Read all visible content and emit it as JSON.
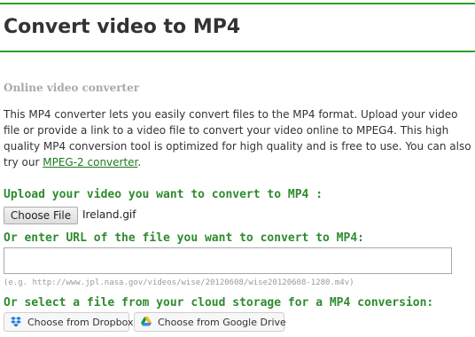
{
  "page": {
    "title": "Convert video to MP4",
    "subtitle": "Online video converter",
    "description_text": "This MP4 converter lets you easily convert files to the MP4 format. Upload your video file or provide a link to a video file to convert your video online to MPEG4. This high quality MP4 conversion tool is optimized for high quality and is free to use. You can also try our ",
    "description_link": "MPEG-2 converter",
    "description_end": "."
  },
  "upload": {
    "heading": "Upload your video you want to convert to MP4 :",
    "button_label": "Choose File",
    "file_name": "Ireland.gif"
  },
  "url": {
    "heading": "Or enter URL of the file you want to convert to MP4:",
    "value": "",
    "example": "(e.g. http://www.jpl.nasa.gov/videos/wise/20120608/wise20120608-1280.m4v)"
  },
  "cloud": {
    "heading": "Or select a file from your cloud storage for a MP4 conversion:",
    "dropbox_label": "Choose from Dropbox",
    "gdrive_label": "Choose from Google Drive"
  },
  "colors": {
    "accent_green": "#2e9e2e",
    "heading_green": "#2e8b2e",
    "link_green": "#1e7a1e",
    "dropbox_blue": "#1f7fd8"
  },
  "icons": {
    "dropbox": "dropbox-icon",
    "gdrive": "google-drive-icon"
  }
}
